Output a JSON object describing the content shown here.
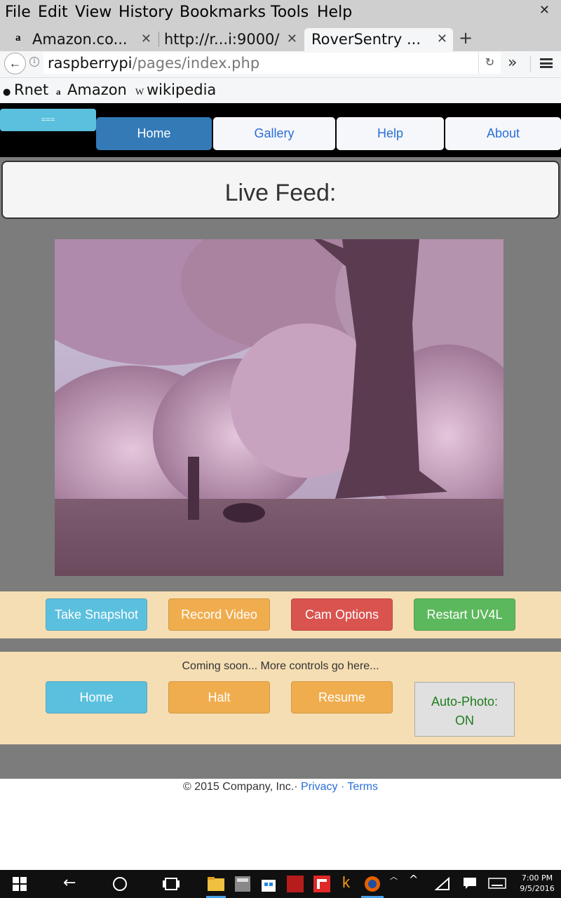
{
  "browser": {
    "menu": [
      "File",
      "Edit",
      "View",
      "History",
      "Bookmarks",
      "Tools",
      "Help"
    ],
    "tabs": [
      {
        "title": "Amazon.co...",
        "favicon": "amazon-icon",
        "active": false
      },
      {
        "title": "http://r...i:9000/",
        "favicon": "",
        "active": false
      },
      {
        "title": "RoverSentry ...",
        "favicon": "",
        "active": true
      }
    ],
    "url": {
      "host": "raspberrypi",
      "path": "/pages/index.php"
    },
    "bookmarks": [
      {
        "label": "Rnet",
        "icon": "globe-icon"
      },
      {
        "label": "Amazon",
        "icon": "amazon-icon"
      },
      {
        "label": "wikipedia",
        "icon": "wikipedia-icon"
      }
    ]
  },
  "nav": {
    "toggle_label": "===",
    "items": [
      {
        "label": "Home",
        "active": true
      },
      {
        "label": "Gallery",
        "active": false
      },
      {
        "label": "Help",
        "active": false
      },
      {
        "label": "About",
        "active": false
      }
    ]
  },
  "feed": {
    "title": "Live Feed:"
  },
  "controls": {
    "row1": [
      "Take Snapshot",
      "Record Video",
      "Cam Options",
      "Restart UV4L"
    ],
    "note": "Coming soon... More controls go here...",
    "row2": [
      "Home",
      "Halt",
      "Resume"
    ],
    "auto_photo": {
      "label": "Auto-Photo:",
      "state": "ON"
    }
  },
  "footer": {
    "copyright": "© 2015 Company, Inc.·",
    "links": [
      "Privacy",
      "Terms"
    ],
    "separator": "·"
  },
  "taskbar": {
    "time": "7:00 PM",
    "date": "9/5/2016"
  },
  "colors": {
    "info": "#5bc0de",
    "warning": "#f0ad4e",
    "danger": "#d9534f",
    "success": "#5cb85c",
    "primary": "#337ab7",
    "panel": "#f5deb3"
  }
}
